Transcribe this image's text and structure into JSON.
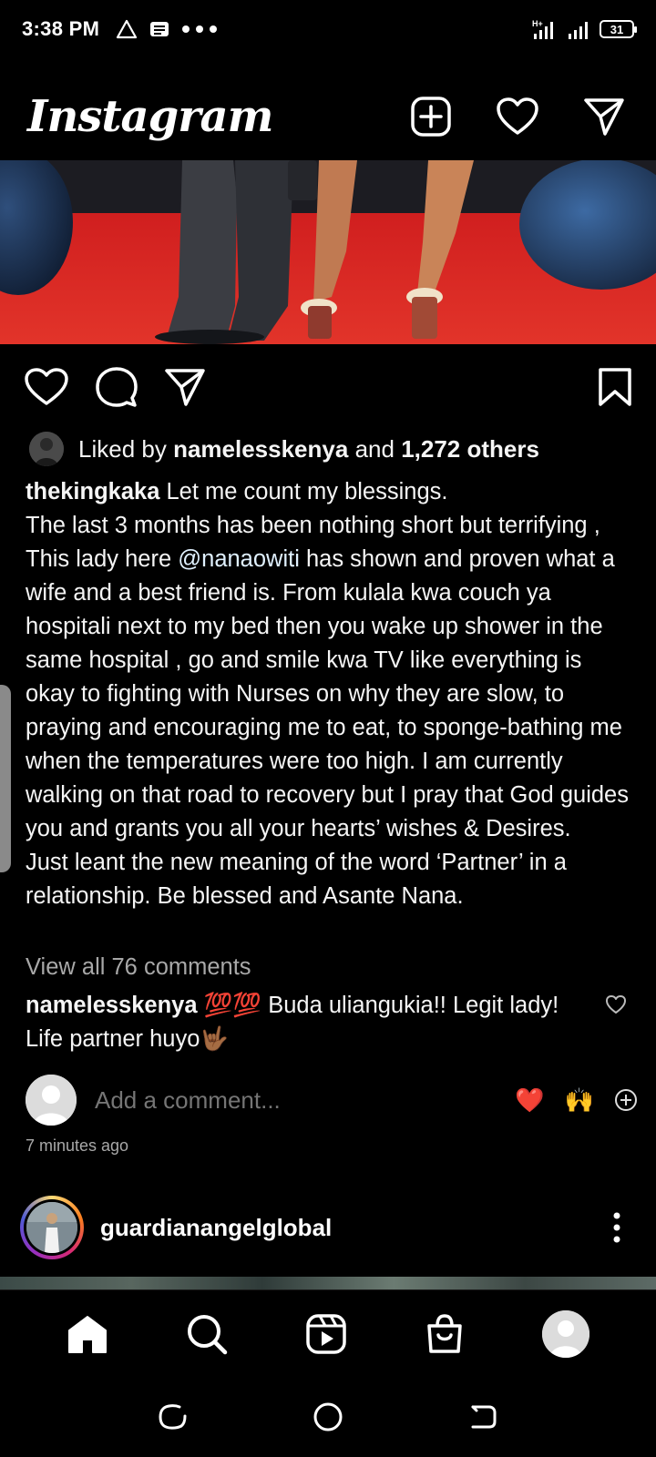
{
  "status_bar": {
    "time": "3:38 PM",
    "battery": "31",
    "network": "H+"
  },
  "header": {
    "logo": "Instagram"
  },
  "post": {
    "liked_by_prefix": "Liked by",
    "liked_by_user": "namelesskenya",
    "liked_by_and": "and",
    "liked_by_others": "1,272 others",
    "caption_username": "thekingkaka",
    "caption_first": " Let me count my blessings.\nThe last 3 months has been nothing short but terrifying , This lady here ",
    "caption_mention": "@nanaowiti",
    "caption_rest": " has shown and proven what a wife and a best friend is. From kulala kwa couch ya hospitali next to my bed then you wake up shower in the same hospital , go and smile kwa TV like everything is okay to fighting with Nurses on why they are slow, to praying and encouraging me to eat, to sponge-bathing me when the temperatures were too high. I am currently walking on that road to recovery but I pray that God guides you and grants you all your hearts’ wishes & Desires.\nJust leant the new meaning of the word ‘Partner’ in a relationship. Be blessed and Asante Nana.",
    "view_comments": "View all 76 comments",
    "top_comment_user": "namelesskenya",
    "top_comment_text": " 💯💯 Buda uliangukia!! Legit lady! Life partner huyo🤟🏾",
    "add_comment_placeholder": "Add a comment...",
    "react_heart": "❤️",
    "react_hands": "🙌",
    "timestamp": "7 minutes ago"
  },
  "next_post": {
    "username": "guardianangelglobal"
  },
  "colors": {
    "background": "#000000",
    "text": "#f5f5f5",
    "muted": "#a8a8a8",
    "carpet_red": "#d9221c"
  }
}
